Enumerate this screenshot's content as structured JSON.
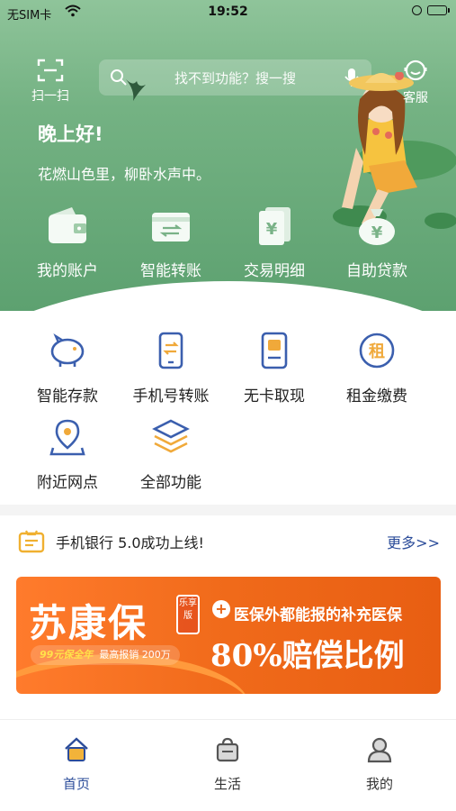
{
  "status_bar": {
    "carrier": "无SIM卡",
    "time": "19:52"
  },
  "header": {
    "scan_label": "扫一扫",
    "search_placeholder": "找不到功能？搜一搜",
    "service_label": "客服",
    "greeting": "晚上好!",
    "poem": "花燃山色里，柳卧水声中。"
  },
  "quick_actions": [
    {
      "label": "我的账户",
      "icon": "wallet-icon"
    },
    {
      "label": "智能转账",
      "icon": "transfer-card-icon"
    },
    {
      "label": "交易明细",
      "icon": "yen-bill-icon"
    },
    {
      "label": "自助贷款",
      "icon": "money-bag-icon"
    }
  ],
  "functions": [
    {
      "label": "智能存款",
      "icon": "piggy-bank-icon"
    },
    {
      "label": "手机号转账",
      "icon": "phone-transfer-icon"
    },
    {
      "label": "无卡取现",
      "icon": "cardless-cash-icon"
    },
    {
      "label": "租金缴费",
      "icon": "rent-icon",
      "glyph": "租"
    },
    {
      "label": "附近网点",
      "icon": "location-pin-icon"
    },
    {
      "label": "全部功能",
      "icon": "layers-icon"
    }
  ],
  "notice": {
    "text": "手机银行 5.0成功上线!",
    "more": "更多>>"
  },
  "banner": {
    "title": "苏康保",
    "stamp": "乐享版",
    "sub_price": "99元保全年",
    "sub_limit": "最高报销 200万",
    "line1": "医保外都能报的补充医保",
    "line2": "80%赔偿比例"
  },
  "tabs": [
    {
      "label": "首页",
      "active": true,
      "icon": "home-icon"
    },
    {
      "label": "生活",
      "active": false,
      "icon": "shopping-bag-icon"
    },
    {
      "label": "我的",
      "active": false,
      "icon": "user-icon"
    }
  ],
  "colors": {
    "header_green": "#74b283",
    "accent_blue": "#2b4c9a",
    "icon_blue": "#3b5fae",
    "banner_orange": "#f06a1a"
  }
}
